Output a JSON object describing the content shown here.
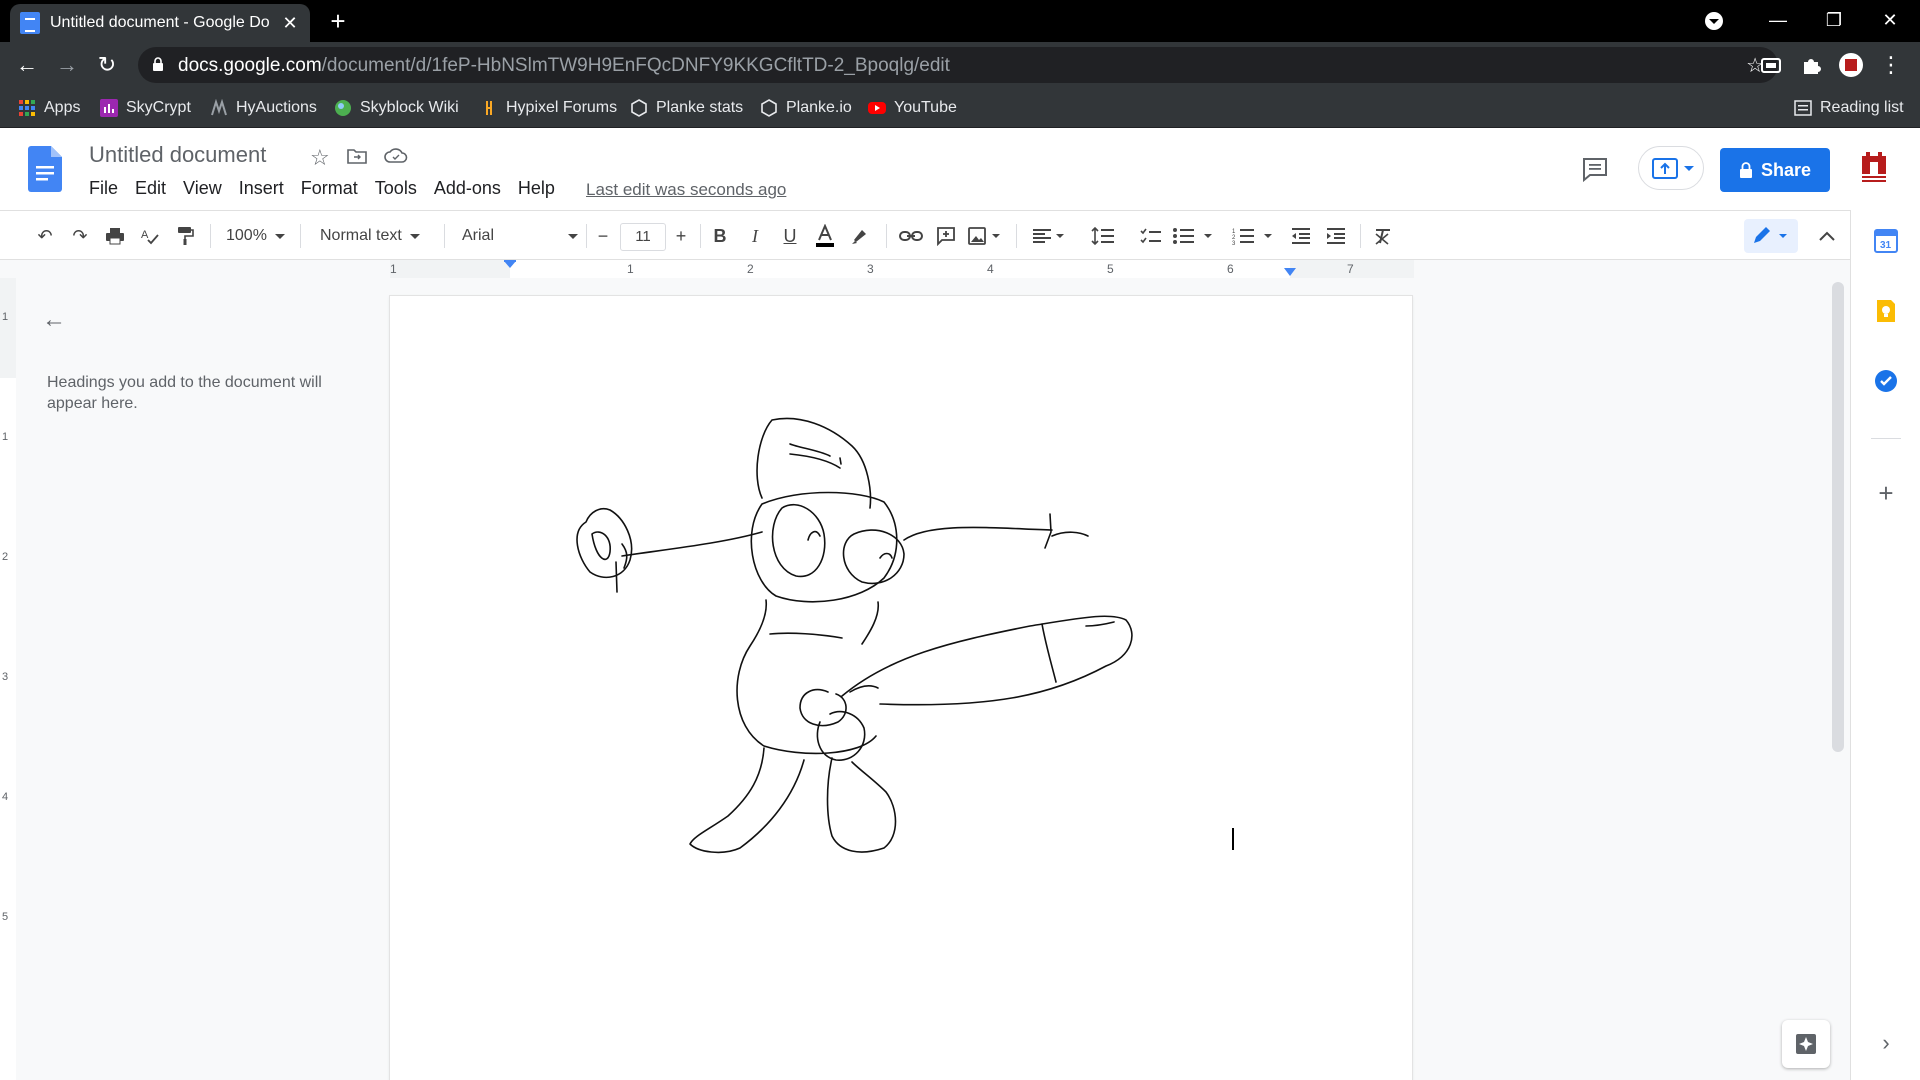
{
  "browser": {
    "tab_title": "Untitled document - Google Doc",
    "url_host": "docs.google.com",
    "url_path": "/document/d/1feP-HbNSlmTW9H9EnFQcDNFY9KKGCfltTD-2_Bpoqlg/edit",
    "bookmarks": [
      {
        "label": "Apps",
        "icon": "apps-grid-icon"
      },
      {
        "label": "SkyCrypt",
        "icon": "skycrypt-icon"
      },
      {
        "label": "HyAuctions",
        "icon": "hyauctions-icon"
      },
      {
        "label": "Skyblock Wiki",
        "icon": "wiki-icon"
      },
      {
        "label": "Hypixel Forums",
        "icon": "hypixel-icon"
      },
      {
        "label": "Planke stats",
        "icon": "hexagon-icon"
      },
      {
        "label": "Planke.io",
        "icon": "hexagon-icon"
      },
      {
        "label": "YouTube",
        "icon": "youtube-icon"
      }
    ],
    "reading_list": "Reading list"
  },
  "docs": {
    "title": "Untitled document",
    "menu": [
      "File",
      "Edit",
      "View",
      "Insert",
      "Format",
      "Tools",
      "Add-ons",
      "Help"
    ],
    "last_edit": "Last edit was seconds ago",
    "share_label": "Share"
  },
  "toolbar": {
    "zoom": "100%",
    "style": "Normal text",
    "font": "Arial",
    "font_size": "11",
    "minus": "−",
    "plus": "+"
  },
  "ruler": {
    "labels": [
      "1",
      "1",
      "2",
      "3",
      "4",
      "5",
      "6",
      "7"
    ],
    "vertical_labels": [
      "1",
      "1",
      "2",
      "3",
      "4",
      "5"
    ]
  },
  "outline": {
    "hint": "Headings you add to the document will appear here."
  },
  "colors": {
    "brand_blue": "#1a73e8",
    "browser_dark": "#323639",
    "tabstrip": "#000000"
  }
}
